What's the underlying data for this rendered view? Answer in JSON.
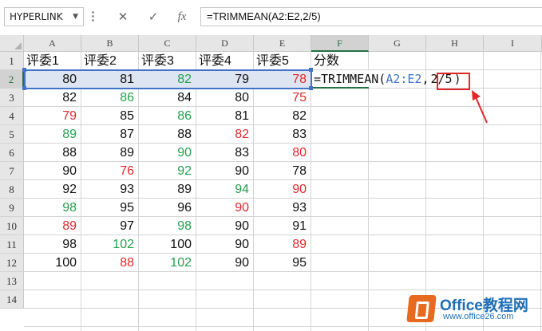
{
  "name_box": {
    "value": "HYPERLINK"
  },
  "formula_bar": {
    "cancel_icon": "✕",
    "enter_icon": "✓",
    "fx_label": "fx",
    "formula": "=TRIMMEAN(A2:E2,2/5)"
  },
  "columns": [
    "A",
    "B",
    "C",
    "D",
    "E",
    "F",
    "G",
    "H",
    "I"
  ],
  "rows": [
    "1",
    "2",
    "3",
    "4",
    "5",
    "6",
    "7",
    "8",
    "9",
    "10",
    "11",
    "12",
    "13",
    "14"
  ],
  "headers": [
    "评委1",
    "评委2",
    "评委3",
    "评委4",
    "评委5",
    "分数"
  ],
  "edit_cell": {
    "prefix": "=TRIMMEAN(",
    "range": "A2:E2",
    "comma": ",",
    "arg": "2/5",
    "suffix": ")"
  },
  "colors": {
    "red": "#e0282b",
    "green": "#23a04d",
    "black": "#111111",
    "range_blue": "#4472c4",
    "excel_green": "#217346"
  },
  "data_rows": [
    [
      {
        "v": "80",
        "c": "k"
      },
      {
        "v": "81",
        "c": "k"
      },
      {
        "v": "82",
        "c": "g"
      },
      {
        "v": "79",
        "c": "k"
      },
      {
        "v": "78",
        "c": "r"
      }
    ],
    [
      {
        "v": "82",
        "c": "k"
      },
      {
        "v": "86",
        "c": "g"
      },
      {
        "v": "84",
        "c": "k"
      },
      {
        "v": "80",
        "c": "k"
      },
      {
        "v": "75",
        "c": "r"
      }
    ],
    [
      {
        "v": "79",
        "c": "r"
      },
      {
        "v": "85",
        "c": "k"
      },
      {
        "v": "86",
        "c": "g"
      },
      {
        "v": "81",
        "c": "k"
      },
      {
        "v": "82",
        "c": "k"
      }
    ],
    [
      {
        "v": "89",
        "c": "g"
      },
      {
        "v": "87",
        "c": "k"
      },
      {
        "v": "88",
        "c": "k"
      },
      {
        "v": "82",
        "c": "r"
      },
      {
        "v": "83",
        "c": "k"
      }
    ],
    [
      {
        "v": "88",
        "c": "k"
      },
      {
        "v": "89",
        "c": "k"
      },
      {
        "v": "90",
        "c": "g"
      },
      {
        "v": "83",
        "c": "k"
      },
      {
        "v": "80",
        "c": "r"
      }
    ],
    [
      {
        "v": "90",
        "c": "k"
      },
      {
        "v": "76",
        "c": "r"
      },
      {
        "v": "92",
        "c": "g"
      },
      {
        "v": "90",
        "c": "k"
      },
      {
        "v": "78",
        "c": "k"
      }
    ],
    [
      {
        "v": "92",
        "c": "k"
      },
      {
        "v": "93",
        "c": "k"
      },
      {
        "v": "89",
        "c": "k"
      },
      {
        "v": "94",
        "c": "g"
      },
      {
        "v": "90",
        "c": "r"
      }
    ],
    [
      {
        "v": "98",
        "c": "g"
      },
      {
        "v": "95",
        "c": "k"
      },
      {
        "v": "96",
        "c": "k"
      },
      {
        "v": "90",
        "c": "r"
      },
      {
        "v": "93",
        "c": "k"
      }
    ],
    [
      {
        "v": "89",
        "c": "r"
      },
      {
        "v": "97",
        "c": "k"
      },
      {
        "v": "98",
        "c": "g"
      },
      {
        "v": "90",
        "c": "k"
      },
      {
        "v": "91",
        "c": "k"
      }
    ],
    [
      {
        "v": "98",
        "c": "k"
      },
      {
        "v": "102",
        "c": "g"
      },
      {
        "v": "100",
        "c": "k"
      },
      {
        "v": "90",
        "c": "k"
      },
      {
        "v": "89",
        "c": "r"
      }
    ],
    [
      {
        "v": "100",
        "c": "k"
      },
      {
        "v": "88",
        "c": "r"
      },
      {
        "v": "102",
        "c": "g"
      },
      {
        "v": "90",
        "c": "k"
      },
      {
        "v": "95",
        "c": "k"
      }
    ]
  ],
  "watermark": {
    "name": "Office教程网",
    "url": "www.office26.com"
  }
}
